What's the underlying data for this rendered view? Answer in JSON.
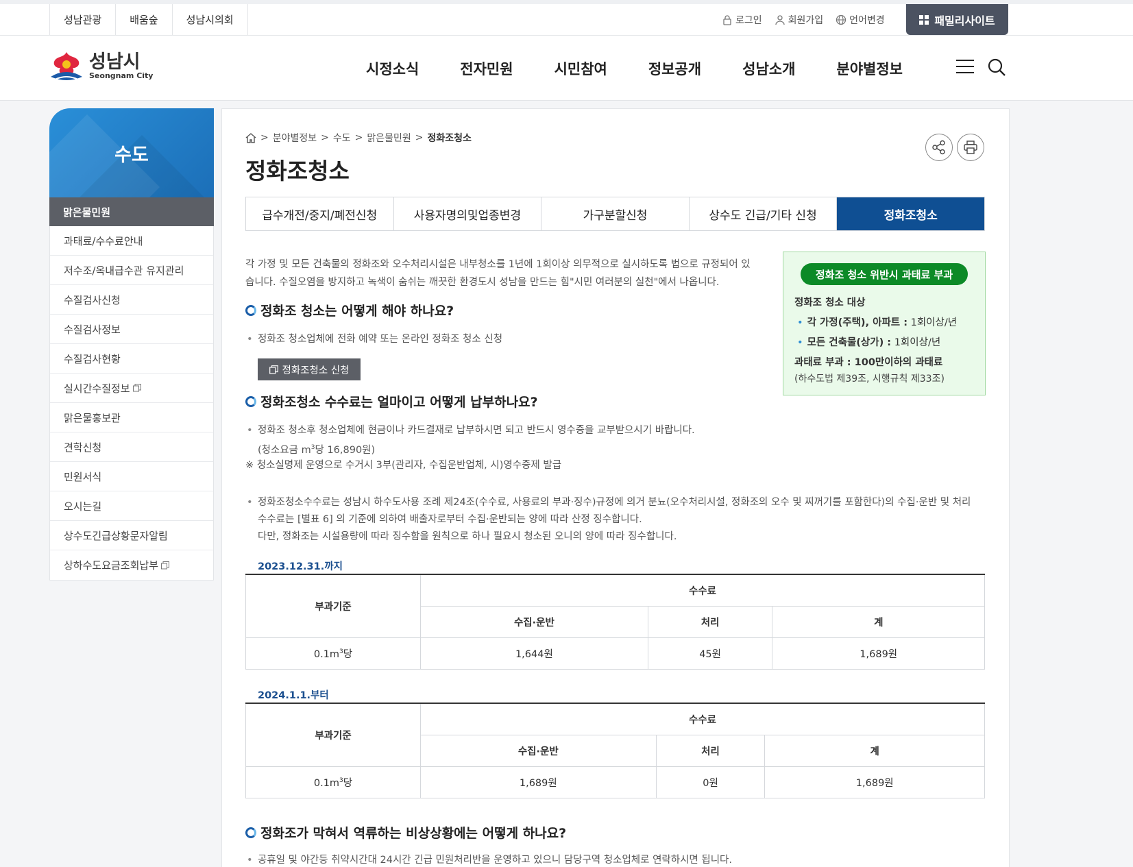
{
  "util": {
    "left_links": [
      "성남관광",
      "배움숲",
      "성남시의회"
    ],
    "login": "로그인",
    "signup": "회원가입",
    "language": "언어변경",
    "family_site": "패밀리사이트"
  },
  "header": {
    "logo_ko": "성남시",
    "logo_en": "Seongnam City",
    "gnb": [
      "시정소식",
      "전자민원",
      "시민참여",
      "정보공개",
      "성남소개",
      "분야별정보"
    ]
  },
  "sidebar": {
    "title": "수도",
    "active": "맑은물민원",
    "items": [
      "과태료/수수료안내",
      "저수조/옥내급수관 유지관리",
      "수질검사신청",
      "수질검사정보",
      "수질검사현황",
      "실시간수질정보",
      "맑은물홍보관",
      "견학신청",
      "민원서식",
      "오시는길",
      "상수도긴급상황문자알림",
      "상하수도요금조회납부"
    ]
  },
  "breadcrumb": [
    "분야별정보",
    "수도",
    "맑은물민원",
    "정화조청소"
  ],
  "page_title": "정화조청소",
  "tabs": [
    "급수개전/중지/폐전신청",
    "사용자명의및업종변경",
    "가구분할신청",
    "상수도 긴급/기타 신청",
    "정화조청소"
  ],
  "intro": "각 가정 및 모든 건축물의 정화조와 오수처리시설은 내부청소를 1년에 1회이상 의무적으로 실시하도록 법으로 규정되어 있습니다. 수질오염을 방지하고 녹색이 숨쉬는 깨끗한 환경도시 성남을 만드는 힘\"시민 여러분의 실천\"에서 나옵니다.",
  "notice": {
    "pill": "정화조 청소 위반시 과태료 부과",
    "label": "정화조 청소 대상",
    "item1_bold": "각 가정(주택), 아파트 :",
    "item1_rest": " 1회이상/년",
    "item2_bold": "모든 건축물(상가) :",
    "item2_rest": " 1회이상/년",
    "fine_bold": "과태료 부과 : 100만이하의 과태료",
    "law": "(하수도법 제39조, 시행규칙 제33조)"
  },
  "sec1": {
    "heading": "정화조 청소는 어떻게 해야 하나요?",
    "bullet": "정화조 청소업체에 전화 예약 또는 온라인 정화조 청소 신청",
    "button": "정화조청소 신청"
  },
  "sec2": {
    "heading": "정화조청소 수수료는 얼마이고 어떻게 납부하나요?",
    "bullet1": "정화조 청소후 청소업체에 현금이나 카드결재로 납부하시면 되고 반드시 영수증을 교부받으시기 바랍니다.",
    "price_pre": "(청소요금 m",
    "price_post": "당 16,890원)",
    "note": "※ 청소실명제 운영으로 수거시 3부(관리자, 수집운반업체, 시)영수증제 발급",
    "bullet2_l1": "정화조청소수수료는 성남시 하수도사용 조례 제24조(수수료, 사용료의 부과·징수)규정에 의거 분뇨(오수처리시설, 정화조의 오수 및 찌꺼기를 포함한다)의 수집·운반 및 처리",
    "bullet2_l2": "수수료는 [별표 6] 의 기준에 의하여 배출자로부터 수집·운반되는 양에 따라 산정 징수합니다.",
    "bullet2_l3": "다만, 정화조는 시설용량에 따라 징수함을 원칙으로 하나 필요시 청소된 오니의 양에 따라 징수합니다."
  },
  "table_headers": {
    "basis": "부과기준",
    "fee": "수수료",
    "collect": "수집·운반",
    "process": "처리",
    "total": "계"
  },
  "table1": {
    "date": "2023.12.31.까지",
    "unit_pre": "0.1m",
    "unit_post": "당",
    "collect": "1,644원",
    "process": "45원",
    "total": "1,689원"
  },
  "table2": {
    "date": "2024.1.1.부터",
    "unit_pre": "0.1m",
    "unit_post": "당",
    "collect": "1,689원",
    "process": "0원",
    "total": "1,689원"
  },
  "sec3": {
    "heading": "정화조가 막혀서 역류하는 비상상황에는 어떻게 하나요?",
    "bullet": "공휴일 및 야간등 취약시간대 24시간 긴급 민원처리반을 운영하고 있으니 담당구역 청소업체로 연락하시면 됩니다."
  },
  "colors": {
    "tab_active": "#0f4f93",
    "pill": "#0c8a27",
    "family": "#4b5261"
  }
}
